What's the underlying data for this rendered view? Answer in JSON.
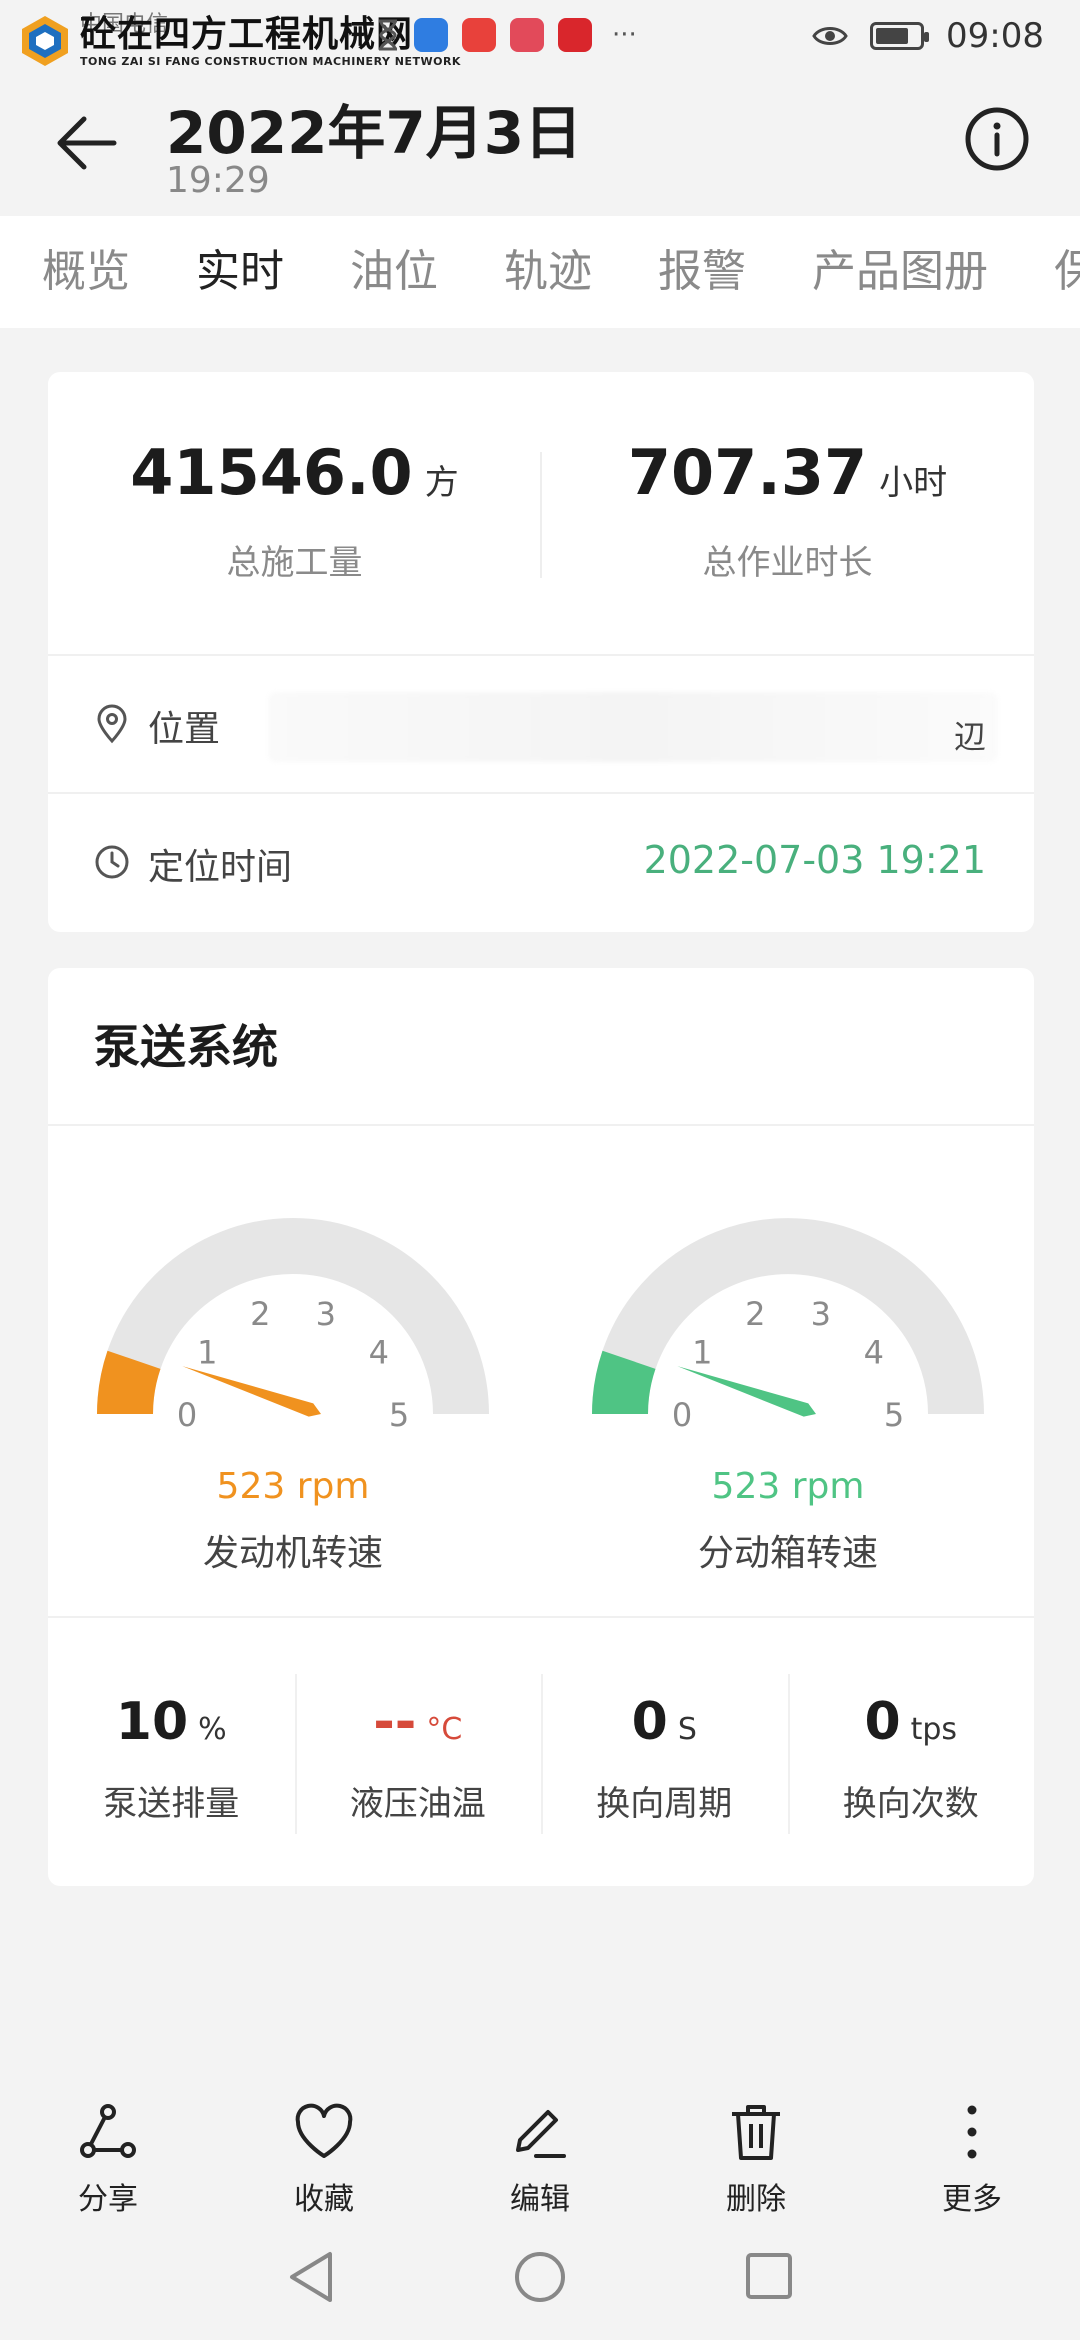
{
  "status_bar": {
    "watermark_title": "砼在四方工程机械网",
    "watermark_sub": "TONG ZAI SI FANG CONSTRUCTION MACHINERY NETWORK",
    "carrier": "中国电信",
    "time": "09:08",
    "battery_level": 0.75
  },
  "header": {
    "title": "2022年7月3日",
    "subtitle": "19:29"
  },
  "tabs": [
    {
      "label": "概览",
      "active": false
    },
    {
      "label": "实时",
      "active": true
    },
    {
      "label": "油位",
      "active": false
    },
    {
      "label": "轨迹",
      "active": false
    },
    {
      "label": "报警",
      "active": false
    },
    {
      "label": "产品图册",
      "active": false
    },
    {
      "label": "保",
      "active": false
    }
  ],
  "summary": {
    "total_volume": {
      "value": "41546.0",
      "unit": "方",
      "label": "总施工量"
    },
    "total_hours": {
      "value": "707.37",
      "unit": "小时",
      "label": "总作业时长"
    }
  },
  "location": {
    "label": "位置",
    "value_suffix": "辺"
  },
  "locate_time": {
    "label": "定位时间",
    "value": "2022-07-03 19:21"
  },
  "pump_system": {
    "title": "泵送系统",
    "gauges": [
      {
        "value": 0.523,
        "reading": "523 rpm",
        "label": "发动机转速",
        "color": "#f0921f",
        "ticks": [
          "0",
          "1",
          "2",
          "3",
          "4",
          "5"
        ]
      },
      {
        "value": 0.523,
        "reading": "523 rpm",
        "label": "分动箱转速",
        "color": "#4fc484",
        "ticks": [
          "0",
          "1",
          "2",
          "3",
          "4",
          "5"
        ]
      }
    ],
    "metrics": [
      {
        "value": "10",
        "unit": "%",
        "label": "泵送排量",
        "alert": false
      },
      {
        "value": "--",
        "unit": "°C",
        "label": "液压油温",
        "alert": true
      },
      {
        "value": "0",
        "unit": "S",
        "label": "换向周期",
        "alert": false
      },
      {
        "value": "0",
        "unit": "tps",
        "label": "换向次数",
        "alert": false
      }
    ]
  },
  "toolbar": [
    {
      "label": "分享",
      "icon": "share-icon"
    },
    {
      "label": "收藏",
      "icon": "heart-icon"
    },
    {
      "label": "编辑",
      "icon": "edit-icon"
    },
    {
      "label": "删除",
      "icon": "trash-icon"
    },
    {
      "label": "更多",
      "icon": "more-icon"
    }
  ],
  "colors": {
    "accent_green": "#49b07d",
    "engine_orange": "#f0921f",
    "gauge_green": "#4fc484",
    "alert_red": "#d64a3a"
  }
}
